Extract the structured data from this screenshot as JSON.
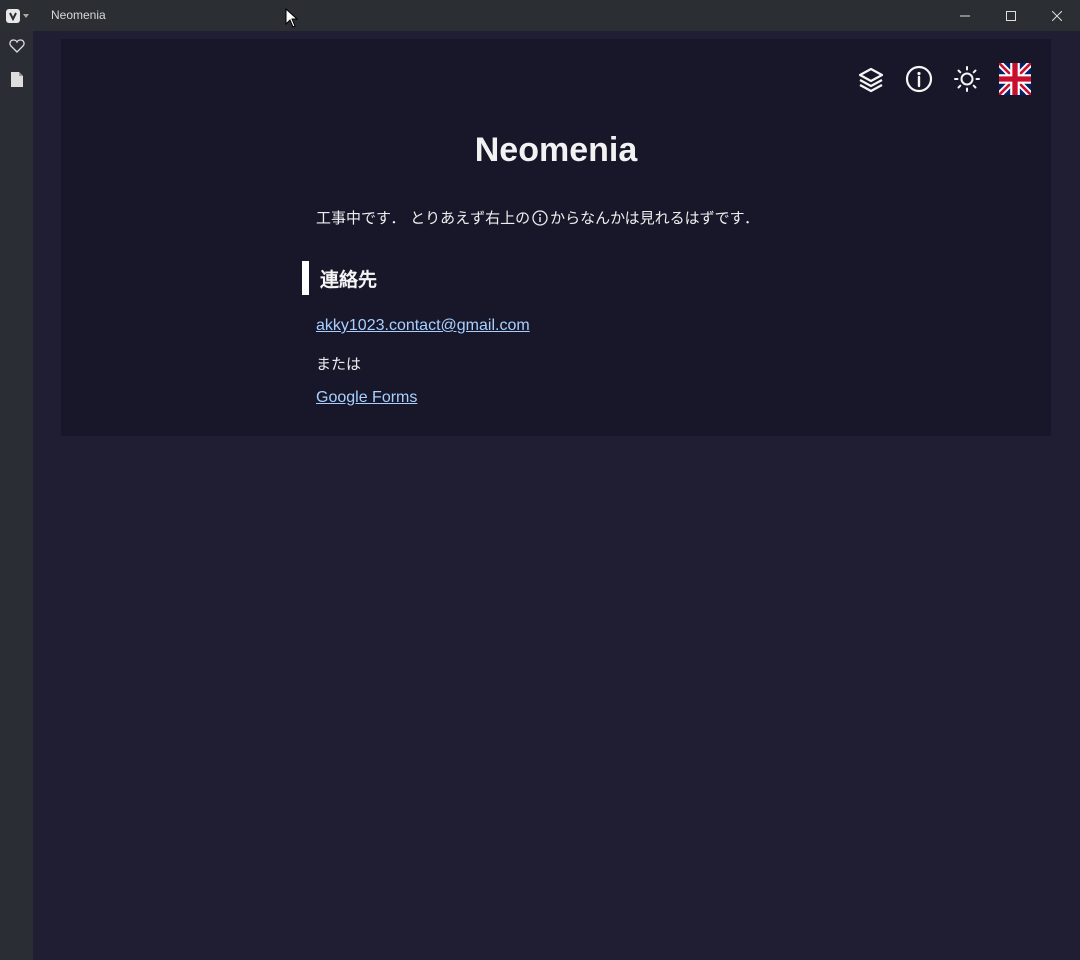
{
  "window": {
    "title": "Neomenia",
    "controls": [
      "minimize-icon",
      "maximize-icon",
      "close-icon"
    ]
  },
  "sidebar": {
    "items": [
      {
        "icon": "heart-icon"
      },
      {
        "icon": "document-icon"
      }
    ]
  },
  "toolbar": {
    "icons": [
      "layers-icon",
      "info-icon",
      "sun-icon",
      "uk-flag-icon"
    ]
  },
  "main": {
    "title": "Neomenia",
    "notice_before": "工事中です． とりあえず右上の",
    "notice_after": "からなんかは見れるはずです．",
    "section_heading": "連絡先",
    "contact_email": "akky1023.contact@gmail.com",
    "or_text": "または",
    "forms_link": "Google Forms"
  },
  "colors": {
    "background": "#1f1e33",
    "card": "#18172a",
    "link": "#a8d0ff",
    "titlebar": "#2b2e33"
  }
}
